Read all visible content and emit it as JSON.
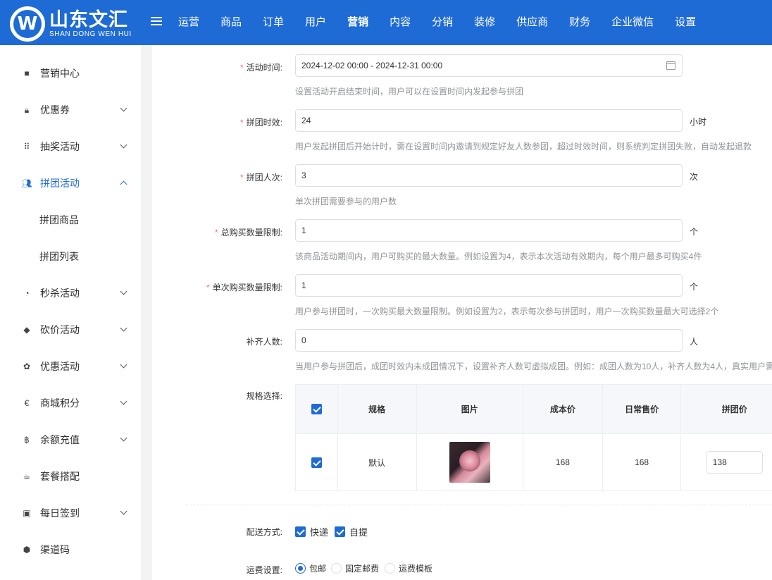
{
  "brand": {
    "logo_letter": "W",
    "name_cn": "山东文汇",
    "name_en": "SHAN DONG WEN HUI"
  },
  "nav": {
    "items": [
      "运营",
      "商品",
      "订单",
      "用户",
      "营销",
      "内容",
      "分销",
      "装修",
      "供应商",
      "财务",
      "企业微信",
      "设置"
    ],
    "active": "营销"
  },
  "sidebar": {
    "items": [
      {
        "label": "营销中心",
        "icon": "marketing-center-icon"
      },
      {
        "label": "优惠券",
        "icon": "coupon-icon"
      },
      {
        "label": "抽奖活动",
        "icon": "lottery-icon"
      },
      {
        "label": "拼团活动",
        "icon": "group-buy-icon"
      },
      {
        "label": "秒杀活动",
        "icon": "flash-sale-icon"
      },
      {
        "label": "砍价活动",
        "icon": "bargain-icon"
      },
      {
        "label": "优惠活动",
        "icon": "discount-icon"
      },
      {
        "label": "商城积分",
        "icon": "points-icon"
      },
      {
        "label": "余额充值",
        "icon": "recharge-icon"
      },
      {
        "label": "套餐搭配",
        "icon": "package-icon"
      },
      {
        "label": "每日签到",
        "icon": "checkin-icon"
      },
      {
        "label": "渠道码",
        "icon": "channel-code-icon"
      }
    ],
    "subitems": [
      "拼团商品",
      "拼团列表"
    ],
    "active_color": "#1f6bd6"
  },
  "form": {
    "activity_time": {
      "label": "活动时间:",
      "value": "2024-12-02 00:00 - 2024-12-31 00:00",
      "tip": "设置活动开启结束时间，用户可以在设置时间内发起参与拼团"
    },
    "group_duration": {
      "label": "拼团时效:",
      "value": "24",
      "unit": "小时",
      "tip": "用户发起拼团后开始计时，需在设置时间内邀请到规定好友人数参团，超过时效时间，则系统判定拼团失败，自动发起退款"
    },
    "group_size": {
      "label": "拼团人次:",
      "value": "3",
      "unit": "次",
      "tip": "单次拼团需要参与的用户数"
    },
    "total_limit": {
      "label": "总购买数量限制:",
      "value": "1",
      "unit": "个",
      "tip": "该商品活动期间内，用户可购买的最大数量。例如设置为4，表示本次活动有效期内，每个用户最多可购买4件"
    },
    "single_limit": {
      "label": "单次购买数量限制:",
      "value": "1",
      "unit": "个",
      "tip": "用户参与拼团时，一次购买最大数量限制。例如设置为2，表示每次参与拼团时，用户一次购买数量最大可选择2个"
    },
    "fill_count": {
      "label": "补齐人数:",
      "value": "0",
      "unit": "人",
      "tip": "当用户参与拼团后，成团时效内未成团情况下，设置补齐人数可虚拟成团。例如：成团人数为10人，补齐人数为4人，真实用户需"
    },
    "spec": {
      "label": "规格选择:",
      "columns": [
        "规格",
        "图片",
        "成本价",
        "日常售价",
        "拼团价"
      ],
      "rows": [
        {
          "spec": "默认",
          "cost": "168",
          "price": "168",
          "group_price": "138"
        }
      ]
    },
    "delivery": {
      "label": "配送方式:",
      "options": [
        "快递",
        "自提"
      ]
    },
    "freight": {
      "label": "运费设置:",
      "options": [
        "包邮",
        "固定邮费",
        "运费模板"
      ],
      "selected": "包邮"
    }
  }
}
